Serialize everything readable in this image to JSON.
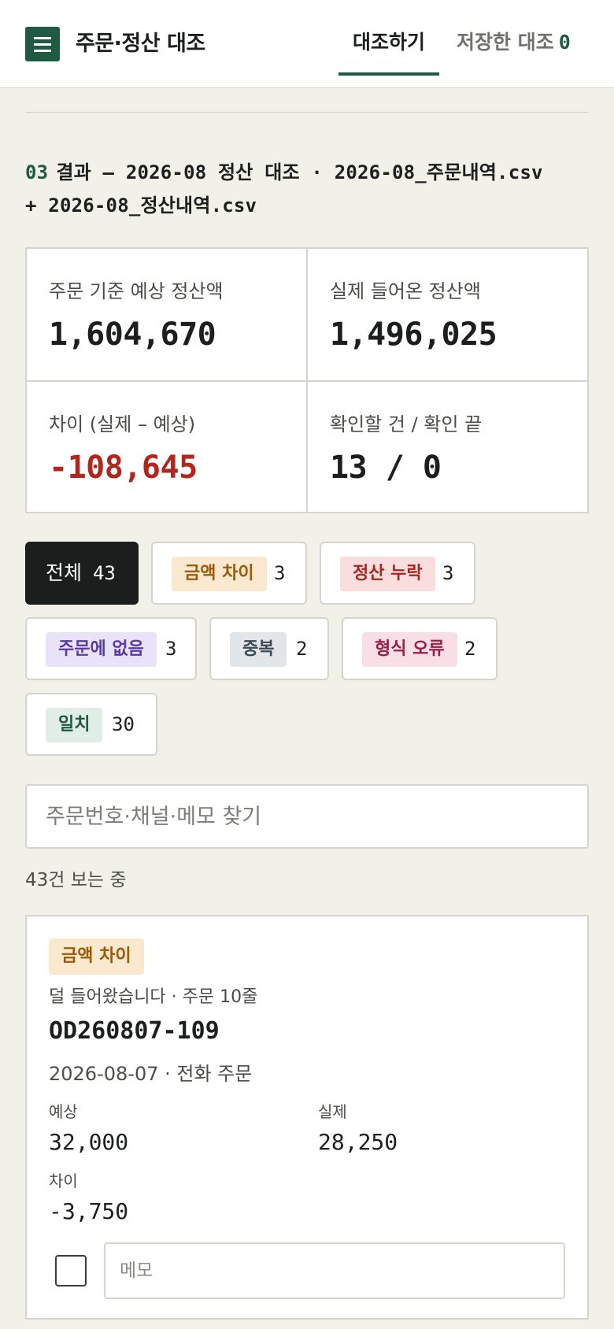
{
  "header": {
    "title": "주문·정산 대조",
    "tab_compare": "대조하기",
    "tab_saved": "저장한 대조",
    "saved_count": "0"
  },
  "result": {
    "step": "03",
    "title_line1": "결과 — 2026-08 정산 대조 · 2026-08_주문내역.csv",
    "title_line2": "+ 2026-08_정산내역.csv"
  },
  "stats": {
    "expected_label": "주문 기준 예상 정산액",
    "expected_value": "1,604,670",
    "actual_label": "실제 들어온 정산액",
    "actual_value": "1,496,025",
    "diff_label": "차이 (실제 – 예상)",
    "diff_value": "-108,645",
    "check_label": "확인할 건 / 확인 끝",
    "check_value": "13 / 0"
  },
  "filters": {
    "all_label": "전체",
    "all_count": "43",
    "amount_label": "금액 차이",
    "amount_count": "3",
    "missing_label": "정산 누락",
    "missing_count": "3",
    "noorder_label": "주문에 없음",
    "noorder_count": "3",
    "dup_label": "중복",
    "dup_count": "2",
    "format_label": "형식 오류",
    "format_count": "2",
    "match_label": "일치",
    "match_count": "30"
  },
  "search": {
    "placeholder": "주문번호·채널·메모 찾기"
  },
  "viewing_text": "43건 보는 중",
  "card": {
    "tag": "금액 차이",
    "desc": "덜 들어왔습니다 · 주문 10줄",
    "order_id": "OD260807-109",
    "meta": "2026-08-07 · 전화 주문",
    "expected_label": "예상",
    "expected_value": "32,000",
    "actual_label": "실제",
    "actual_value": "28,250",
    "diff_label": "차이",
    "diff_value": "-3,750",
    "memo_placeholder": "메모"
  }
}
